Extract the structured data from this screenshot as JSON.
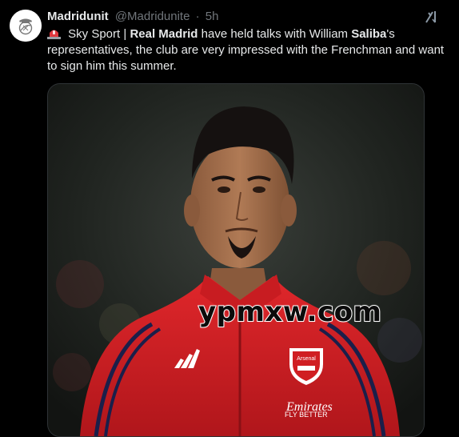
{
  "tweet": {
    "author": {
      "display_name": "Madridunit",
      "handle": "@Madridunite",
      "separator": "·",
      "timestamp": "5h"
    },
    "body": {
      "line1_after_emoji": " Sky Sport | ",
      "bold_club": "Real Madrid",
      "line1_mid": " have held talks with William ",
      "bold_player": "Saliba",
      "line1_end": "'s",
      "line2": "representatives, the club are very impressed with the Frenchman and want",
      "line3": "to sign him this summer.",
      "emoji": "siren-emoji"
    },
    "media": {
      "alt": "photo",
      "watermark": "ypmxw.com",
      "badge_text": "Arsenal",
      "sponsor_text": "FLY BETTER",
      "sponsor_brand": "Emirates"
    },
    "icons": {
      "avatar": "real-madrid-crest-icon",
      "grok": "grok-icon"
    }
  },
  "colors": {
    "background": "#000000",
    "text_primary": "#e7e9ea",
    "text_secondary": "#71767b",
    "jersey_red": "#d01e22",
    "jersey_trim": "#1b1f4a"
  }
}
